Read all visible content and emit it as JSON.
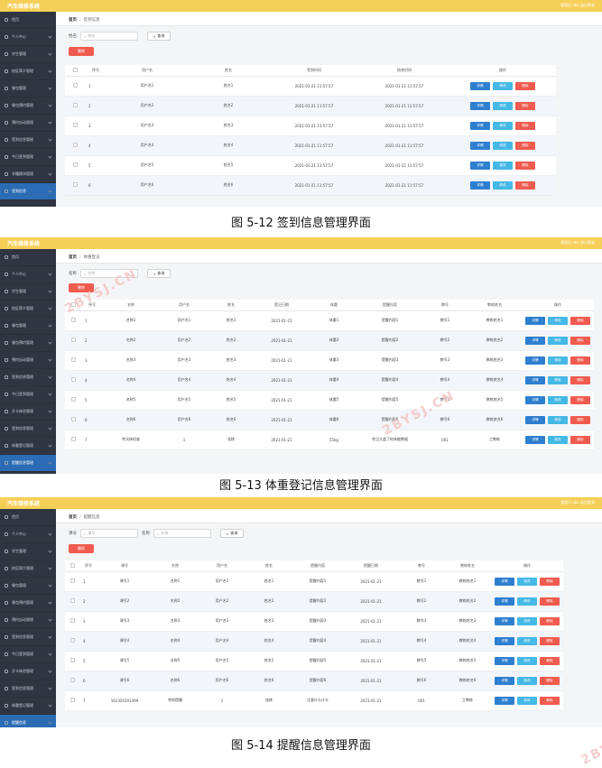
{
  "panels": [
    {
      "app_title": "汽车维修系统",
      "user_info": "管理员 abo   退出登录",
      "breadcrumb": {
        "home": "首页",
        "current": "签到信息"
      },
      "search": [
        {
          "label": "姓名",
          "placeholder": "姓名"
        }
      ],
      "search_button": "查询",
      "delete_button": "删除",
      "sidebar": [
        "首页",
        "个人中心",
        "学生管理",
        "校区简介管理",
        "餐包管理",
        "餐包预约管理",
        "预约自动管理",
        "签到信息管理",
        "今日签到管理",
        "学籍模块管理",
        "签到信息"
      ],
      "columns": [
        "",
        "序号",
        "用户名",
        "姓名",
        "签到时间",
        "结束时间",
        "操作"
      ],
      "rows": [
        [
          "1",
          "用户名1",
          "姓名1",
          "2021-01-21 11:57:57",
          "2021-01-21 11:57:57"
        ],
        [
          "2",
          "用户名2",
          "姓名2",
          "2021-01-21 11:57:57",
          "2021-01-21 11:57:57"
        ],
        [
          "3",
          "用户名3",
          "姓名3",
          "2021-01-21 11:57:57",
          "2021-01-21 11:57:57"
        ],
        [
          "4",
          "用户名4",
          "姓名4",
          "2021-01-21 11:57:57",
          "2021-01-21 11:57:57"
        ],
        [
          "5",
          "用户名5",
          "姓名5",
          "2021-01-21 11:57:57",
          "2021-01-21 11:57:57"
        ],
        [
          "6",
          "用户名6",
          "姓名6",
          "2021-01-21 11:57:57",
          "2021-01-21 11:57:57"
        ]
      ],
      "actions": [
        "详情",
        "修改",
        "删除"
      ],
      "caption": "图 5-12 签到信息管理界面"
    },
    {
      "app_title": "汽车维修系统",
      "user_info": "管理员 abo   退出登录",
      "breadcrumb": {
        "home": "首页",
        "current": "体重登记"
      },
      "search": [
        {
          "label": "名称",
          "placeholder": "名称"
        }
      ],
      "search_button": "查询",
      "delete_button": "删除",
      "sidebar": [
        "首页",
        "个人中心",
        "学生管理",
        "校区简介管理",
        "餐包管理",
        "餐包预约管理",
        "预约自动管理",
        "签到信息管理",
        "今日签到管理",
        "开卡体验管理",
        "签到信息管理",
        "体重登记管理",
        "提醒信息管理"
      ],
      "columns": [
        "",
        "序号",
        "名称",
        "用户名",
        "姓名",
        "登记日期",
        "体重",
        "提醒内容",
        "教号",
        "教练姓名",
        "操作"
      ],
      "rows": [
        [
          "1",
          "名称1",
          "用户名1",
          "姓名1",
          "2021-01-21",
          "体重1",
          "提醒内容1",
          "教号1",
          "教练姓名1"
        ],
        [
          "2",
          "名称2",
          "用户名2",
          "姓名2",
          "2021-01-21",
          "体重2",
          "提醒内容2",
          "教号2",
          "教练姓名2"
        ],
        [
          "3",
          "名称3",
          "用户名3",
          "姓名3",
          "2021-01-21",
          "体重3",
          "提醒内容3",
          "教号3",
          "教练姓名3"
        ],
        [
          "4",
          "名称4",
          "用户名4",
          "姓名4",
          "2021-01-21",
          "体重4",
          "提醒内容4",
          "教号4",
          "教练姓名4"
        ],
        [
          "5",
          "名称5",
          "用户名5",
          "姓名5",
          "2021-01-21",
          "体重5",
          "提醒内容5",
          "教号5",
          "教练姓名5"
        ],
        [
          "6",
          "名称6",
          "用户名6",
          "姓名6",
          "2021-01-21",
          "体重6",
          "提醒内容6",
          "教号6",
          "教练姓名6"
        ],
        [
          "7",
          "考试体检查",
          "1",
          "张棱",
          "2021-01-21",
          "55kg",
          "考点大盖了的体能数据",
          "001",
          "工教练"
        ]
      ],
      "actions": [
        "详情",
        "修改",
        "删除"
      ],
      "caption": "图 5-13 体重登记信息管理界面"
    },
    {
      "app_title": "汽车维修系统",
      "user_info": "管理员 abo   退出登录",
      "breadcrumb": {
        "home": "首页",
        "current": "提醒信息"
      },
      "search": [
        {
          "label": "课号",
          "placeholder": "课号"
        },
        {
          "label": "名称",
          "placeholder": "名称"
        }
      ],
      "search_button": "查询",
      "delete_button": "删除",
      "sidebar": [
        "首页",
        "个人中心",
        "学生管理",
        "校区简介管理",
        "餐包管理",
        "餐包预约管理",
        "预约自动管理",
        "签到信息管理",
        "今日签到管理",
        "开卡体验管理",
        "签到信息管理",
        "体重登记管理",
        "提醒信息"
      ],
      "columns": [
        "",
        "序号",
        "课号",
        "名称",
        "用户名",
        "姓名",
        "提醒内容",
        "提醒日期",
        "教号",
        "教练姓名",
        "操作"
      ],
      "rows": [
        [
          "1",
          "课号1",
          "名称1",
          "用户名1",
          "姓名1",
          "提醒内容1",
          "2021-01-21",
          "教号1",
          "教练姓名1"
        ],
        [
          "2",
          "课号2",
          "名称2",
          "用户名2",
          "姓名2",
          "提醒内容2",
          "2021-01-21",
          "教号2",
          "教练姓名2"
        ],
        [
          "3",
          "课号3",
          "名称3",
          "用户名3",
          "姓名3",
          "提醒内容3",
          "2021-01-21",
          "教号3",
          "教练姓名3"
        ],
        [
          "4",
          "课号4",
          "名称4",
          "用户名4",
          "姓名4",
          "提醒内容4",
          "2021-01-21",
          "教号4",
          "教练姓名4"
        ],
        [
          "5",
          "课号5",
          "名称5",
          "用户名5",
          "姓名5",
          "提醒内容5",
          "2021-01-21",
          "教号5",
          "教练姓名5"
        ],
        [
          "6",
          "课号6",
          "名称6",
          "用户名6",
          "姓名6",
          "提醒内容6",
          "2021-01-21",
          "教号6",
          "教练姓名6"
        ],
        [
          "7",
          "161320101399",
          "考前提醒",
          "1",
          "张棱",
          "注意什么什么",
          "2021-01-21",
          "001",
          "工教练"
        ]
      ],
      "actions": [
        "详情",
        "修改",
        "删除"
      ],
      "caption": "图 5-14 提醒信息管理界面"
    }
  ],
  "watermark": "2BYSJ.CN",
  "colors": {
    "topbar": "#f6cf58",
    "sidebar": "#303641",
    "detail": "#2f7fd0",
    "edit": "#45b8e5",
    "delete": "#f05b4f"
  }
}
